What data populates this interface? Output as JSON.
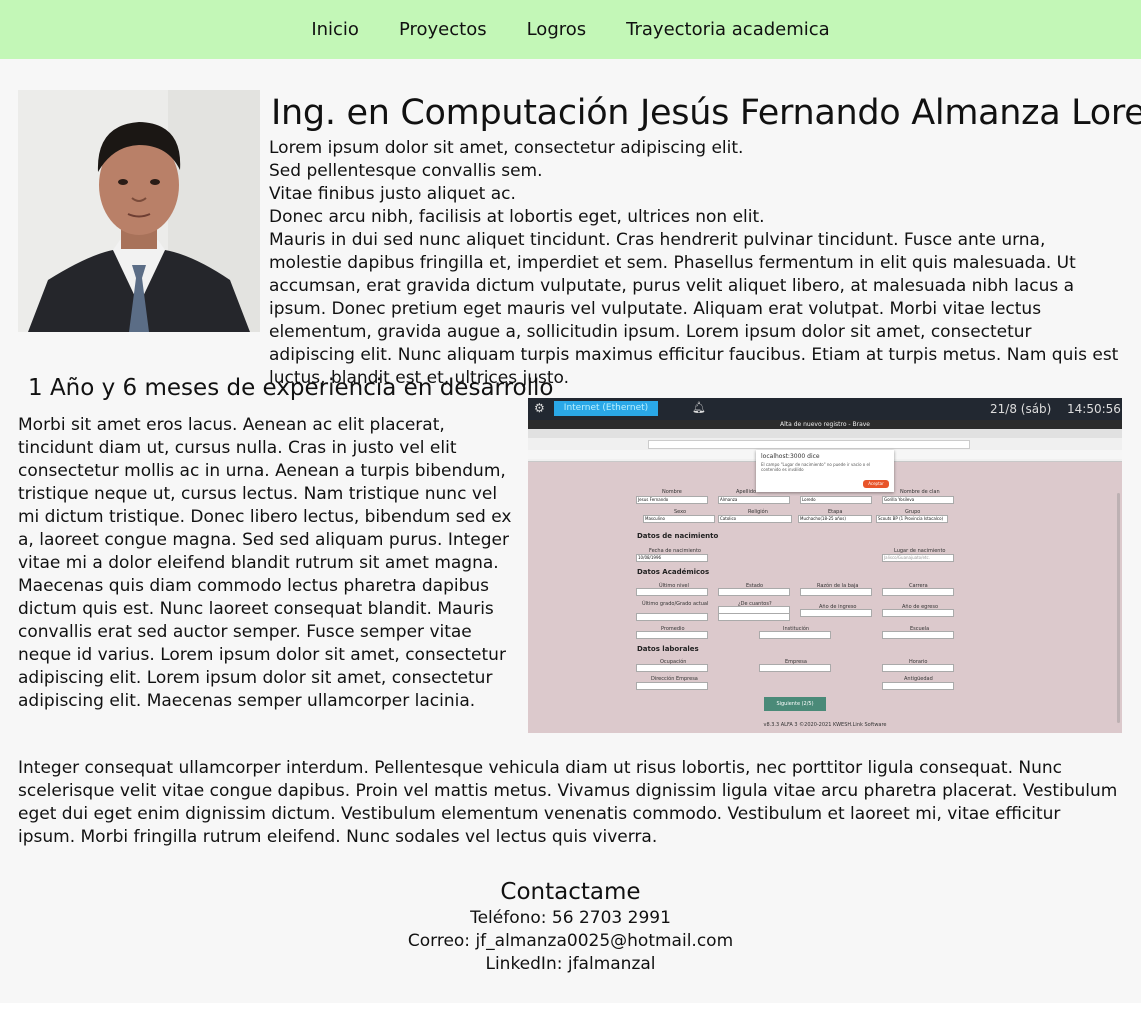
{
  "nav": {
    "items": [
      "Inicio",
      "Proyectos",
      "Logros",
      "Trayectoria academica"
    ]
  },
  "header": {
    "title": "Ing. en Computación Jesús Fernando Almanza Loredo"
  },
  "intro": {
    "lines": [
      "Lorem ipsum dolor sit amet, consectetur adipiscing elit.",
      "Sed pellentesque convallis sem.",
      "Vitae finibus justo aliquet ac.",
      "Donec arcu nibh, facilisis at lobortis eget, ultrices non elit.",
      "Mauris in dui sed nunc aliquet tincidunt. Cras hendrerit pulvinar tincidunt. Fusce ante urna, molestie dapibus fringilla et, imperdiet et sem. Phasellus fermentum in elit quis malesuada. Ut accumsan, erat gravida dictum vulputate, purus velit aliquet libero, at malesuada nibh lacus a ipsum. Donec pretium eget mauris vel vulputate. Aliquam erat volutpat. Morbi vitae lectus elementum, gravida augue a, sollicitudin ipsum. Lorem ipsum dolor sit amet, consectetur adipiscing elit. Nunc aliquam turpis maximus efficitur faucibus. Etiam at turpis metus. Nam quis est luctus, blandit est et, ultrices justo."
    ]
  },
  "experience": {
    "title": "1 Año y 6 meses de experiencia en desarrollo",
    "text": "Morbi sit amet eros lacus. Aenean ac elit placerat, tincidunt diam ut, cursus nulla. Cras in justo vel elit consectetur mollis ac in urna. Aenean a turpis bibendum, tristique neque ut, cursus lectus. Nam tristique nunc vel mi dictum tristique. Donec libero lectus, bibendum sed ex a, laoreet congue magna. Sed sed aliquam purus. Integer vitae mi a dolor eleifend blandit rutrum sit amet magna. Maecenas quis diam commodo lectus pharetra dapibus dictum quis est. Nunc laoreet consequat blandit. Mauris convallis erat sed auctor semper. Fusce semper vitae neque id varius. Lorem ipsum dolor sit amet, consectetur adipiscing elit. Lorem ipsum dolor sit amet, consectetur adipiscing elit. Maecenas semper ullamcorper lacinia."
  },
  "screenshot": {
    "topbar_tab": "Internet (Ethernet)",
    "date": "21/8 (sáb)",
    "time": "14:50:56",
    "window_title": "Alta de nuevo registro - Brave",
    "dialog_title": "localhost:3000 dice",
    "dialog_text": "El campo \"Lugar de nacimiento\" no puede ir vacío o el contenido es inválido",
    "dialog_button": "Aceptar",
    "sections": [
      "Datos de nacimiento",
      "Datos Académicos",
      "Datos laborales"
    ],
    "labels": [
      "Nombre",
      "Apellido",
      "Nombre de clan",
      "Sexo",
      "Religión",
      "Etapa",
      "Grupo",
      "Fecha de nacimiento",
      "Lugar de nacimiento",
      "Último nivel",
      "Estado",
      "Razón de la baja",
      "Carrera",
      "Último grado/Grado actual",
      "¿De cuantos?",
      "Año de ingreso",
      "Año de egreso",
      "Promedio",
      "Institución",
      "Escuela",
      "Ocupación",
      "Empresa",
      "Horario",
      "Dirección Empresa",
      "Antigüedad"
    ],
    "values": [
      "Jesus Fernando",
      "Almanza",
      "Loredo",
      "Gorilla Yosileva",
      "Masculino",
      "Catolico",
      "Muchacho(18-25 años)",
      "Scouts BP (1 Provincia Istacalco)",
      "10/08/1996",
      "Jalisco/Guanajuato/etc."
    ],
    "next_button": "Siguiente (2/5)",
    "footer": "v8.3.3 ALFA 3 ©2020-2021 KWESH.Link Software"
  },
  "bottom": {
    "text": "Integer consequat ullamcorper interdum. Pellentesque vehicula diam ut risus lobortis, nec porttitor ligula consequat. Nunc scelerisque velit vitae congue dapibus. Proin vel mattis metus. Vivamus dignissim ligula vitae arcu pharetra placerat. Vestibulum eget dui eget enim dignissim dictum. Vestibulum elementum venenatis commodo. Vestibulum et laoreet mi, vitae efficitur ipsum. Morbi fringilla rutrum eleifend. Nunc sodales vel lectus quis viverra."
  },
  "contact": {
    "title": "Contactame",
    "phone": "Teléfono: 56 2703 2991",
    "email": "Correo: jf_almanza0025@hotmail.com",
    "linkedin": "LinkedIn: jfalmanzal"
  },
  "colors": {
    "nav_bg": "#c3f7b7",
    "page_bg": "#f7f7f7",
    "form_bg": "#dcc9cc",
    "next_button": "#4a8a78"
  }
}
